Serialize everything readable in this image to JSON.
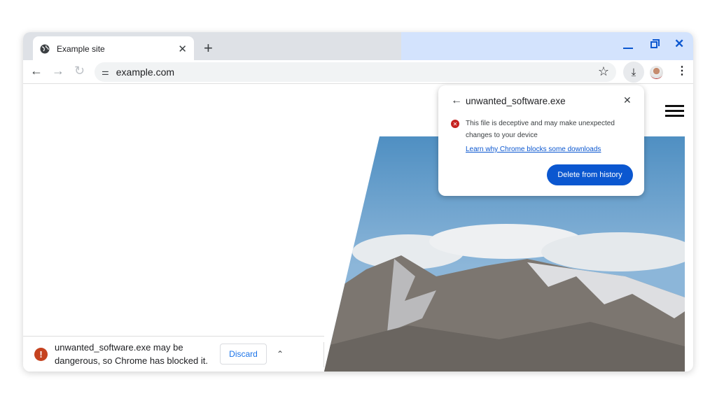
{
  "tab": {
    "title": "Example site",
    "icon": "globe-icon"
  },
  "omnibox": {
    "url": "example.com"
  },
  "popup": {
    "title": "unwanted_software.exe",
    "message": "This file is deceptive and may make unexpected changes to your device",
    "link": "Learn why Chrome blocks some downloads",
    "button": "Delete from history"
  },
  "download_bar": {
    "message_line1": "unwanted_software.exe may be",
    "message_line2": "dangerous, so Chrome has blocked it.",
    "discard": "Discard"
  },
  "colors": {
    "accent": "#0b57d0",
    "danger": "#c5221f",
    "tabstrip_new": "#d3e3fd",
    "tabstrip_old": "#dee1e6"
  }
}
